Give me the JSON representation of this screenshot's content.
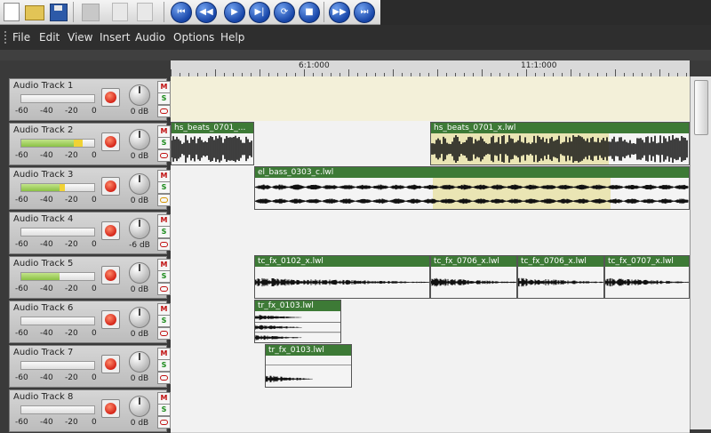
{
  "menu": [
    "File",
    "Edit",
    "View",
    "Insert",
    "Audio",
    "Options",
    "Help"
  ],
  "toolbar": {
    "file_buttons": [
      "new-document-icon",
      "open-folder-icon",
      "save-disk-icon",
      "cut-icon",
      "copy-icon",
      "paste-icon"
    ],
    "transport_buttons": [
      "go-to-start-icon",
      "rewind-icon",
      "play-icon",
      "play-from-cursor-icon",
      "loop-icon",
      "stop-icon",
      "fast-forward-icon",
      "go-to-end-icon"
    ]
  },
  "ruler": {
    "labels": [
      "6:1:000",
      "11:1:000"
    ]
  },
  "meter_scale": [
    "-60",
    "-40",
    "-20",
    "0"
  ],
  "tracks": [
    {
      "name": "Audio Track 1",
      "gain": "0 dB",
      "meter_level": 0,
      "peak": 0
    },
    {
      "name": "Audio Track 2",
      "gain": "0 dB",
      "meter_level": 0.72,
      "peak": 0.12
    },
    {
      "name": "Audio Track 3",
      "gain": "0 dB",
      "meter_level": 0.52,
      "peak": 0.08
    },
    {
      "name": "Audio Track 4",
      "gain": "-6 dB",
      "meter_level": 0,
      "peak": 0
    },
    {
      "name": "Audio Track 5",
      "gain": "0 dB",
      "meter_level": 0.52,
      "peak": 0
    },
    {
      "name": "Audio Track 6",
      "gain": "0 dB",
      "meter_level": 0,
      "peak": 0
    },
    {
      "name": "Audio Track 7",
      "gain": "0 dB",
      "meter_level": 0,
      "peak": 0
    },
    {
      "name": "Audio Track 8",
      "gain": "0 dB",
      "meter_level": 0,
      "peak": 0
    }
  ],
  "clips": [
    {
      "track": 1,
      "name": "hs_beats_0701_...",
      "style": "dense"
    },
    {
      "track": 1,
      "name": "hs_beats_0701_x.lwl",
      "style": "dense"
    },
    {
      "track": 2,
      "name": "el_bass_0303_c.lwl",
      "style": "bass"
    },
    {
      "track": 4,
      "name": "tc_fx_0102_x.lwl",
      "style": "fx"
    },
    {
      "track": 4,
      "name": "tc_fx_0706_x.lwl",
      "style": "fx"
    },
    {
      "track": 4,
      "name": "tc_fx_0706_x.lwl",
      "style": "fx"
    },
    {
      "track": 4,
      "name": "tc_fx_0707_x.lwl",
      "style": "fx"
    },
    {
      "track": 5,
      "name": "tr_fx_0103.lwl",
      "style": "stack"
    },
    {
      "track": 6,
      "name": "tr_fx_0103.lwl",
      "style": "short"
    }
  ]
}
